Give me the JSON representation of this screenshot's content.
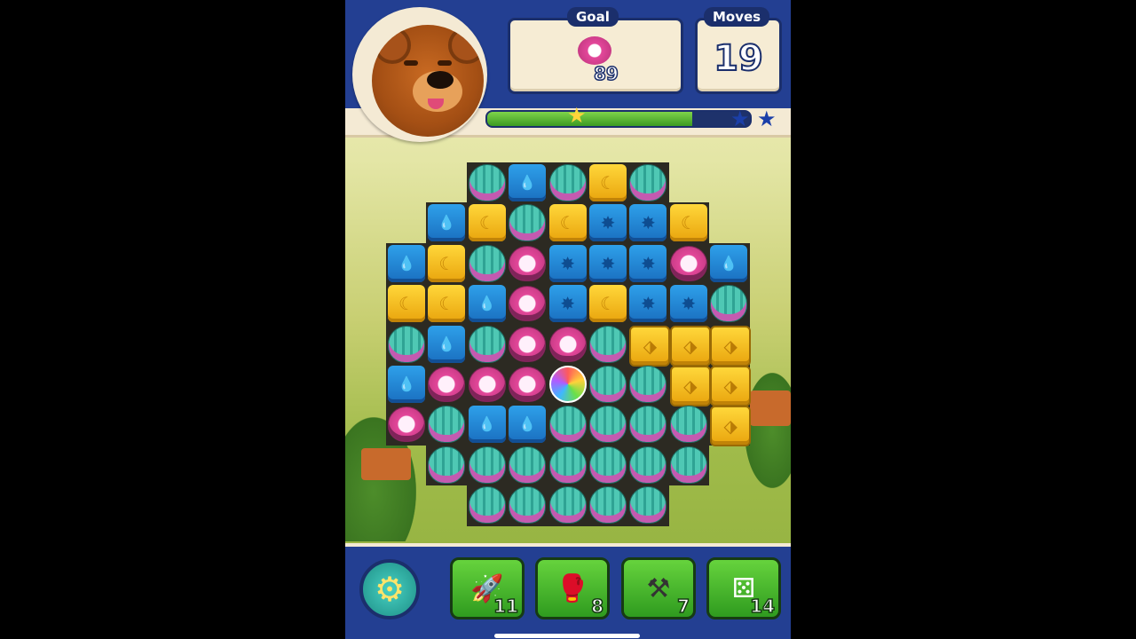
{
  "hud": {
    "goal_label": "Goal",
    "goal_icon": "pearl-shell-icon",
    "goal_count": "89",
    "moves_label": "Moves",
    "moves_value": "19",
    "progress_fraction": 0.78
  },
  "board": {
    "rows": [
      [
        null,
        null,
        "shell",
        "blue",
        "shell",
        "yellow",
        "shell",
        null,
        null
      ],
      [
        null,
        "blue",
        "yellow",
        "shell",
        "yellow",
        "bstar",
        "bstar",
        "yellow",
        null
      ],
      [
        "blue",
        "yellow",
        "shell",
        "pearl",
        "bstar",
        "bstar",
        "bstar",
        "pearl",
        "blue"
      ],
      [
        "yellow",
        "yellow",
        "blue",
        "pearl",
        "bstar",
        "yellow",
        "bstar",
        "bstar",
        "shell"
      ],
      [
        "shell",
        "blue",
        "shell",
        "pearl",
        "pearl",
        "shell",
        "gold",
        "gold",
        "gold"
      ],
      [
        "blue",
        "pearl",
        "pearl",
        "pearl",
        "disco",
        "shell",
        "shell",
        "gold",
        "gold"
      ],
      [
        "pearl",
        "shell",
        "blue",
        "blue",
        "shell",
        "shell",
        "shell",
        "shell",
        "gold"
      ],
      [
        null,
        "shell",
        "shell",
        "shell",
        "shell",
        "shell",
        "shell",
        "shell",
        null
      ],
      [
        null,
        null,
        "shell",
        "shell",
        "shell",
        "shell",
        "shell",
        null,
        null
      ]
    ]
  },
  "boosters": [
    {
      "icon": "rocket-icon",
      "count": "11"
    },
    {
      "icon": "boxing-glove-icon",
      "count": "8"
    },
    {
      "icon": "anvil-icon",
      "count": "7"
    },
    {
      "icon": "dice-icon",
      "count": "14"
    }
  ],
  "colors": {
    "hud_blue": "#233f92",
    "panel": "#f6ecd4",
    "progress_green": "#3c9a22"
  }
}
